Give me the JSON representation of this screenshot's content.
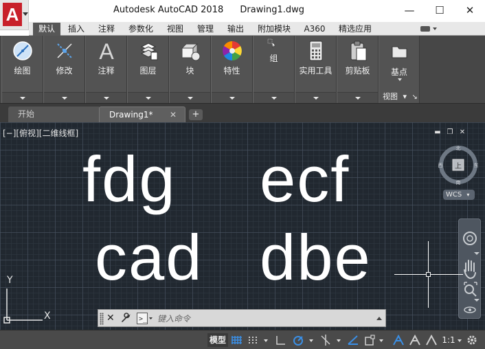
{
  "window": {
    "app_name": "Autodesk AutoCAD 2018",
    "document": "Drawing1.dwg",
    "minimize": "—",
    "maximize": "☐",
    "close": "✕",
    "app_logo_letter": "A"
  },
  "ribbon_tabs": [
    {
      "label": "默认",
      "active": true
    },
    {
      "label": "插入"
    },
    {
      "label": "注释"
    },
    {
      "label": "参数化"
    },
    {
      "label": "视图"
    },
    {
      "label": "管理"
    },
    {
      "label": "输出"
    },
    {
      "label": "附加模块"
    },
    {
      "label": "A360"
    },
    {
      "label": "精选应用"
    }
  ],
  "ribbon_panels": [
    {
      "label": "绘图",
      "icon": "draw-icon"
    },
    {
      "label": "修改",
      "icon": "modify-icon"
    },
    {
      "label": "注释",
      "icon": "annotation-icon"
    },
    {
      "label": "图层",
      "icon": "layers-icon"
    },
    {
      "label": "块",
      "icon": "block-icon"
    },
    {
      "label": "特性",
      "icon": "properties-icon"
    },
    {
      "label": "组",
      "icon": "group-icon"
    },
    {
      "label": "实用工具",
      "icon": "utilities-icon"
    },
    {
      "label": "剪贴板",
      "icon": "clipboard-icon"
    },
    {
      "label": "基点",
      "icon": "base-point-icon"
    }
  ],
  "view_panel_label": "视图",
  "file_tabs": {
    "start": "开始",
    "drawing": "Drawing1*",
    "close": "✕",
    "add": "+"
  },
  "viewport": {
    "label": "[−][俯视][二维线框]",
    "texts": [
      "fdg",
      "ecf",
      "cad",
      "dbe"
    ],
    "viewcube": {
      "top": "上",
      "north": "北",
      "south": "南",
      "east": "东",
      "west": "西"
    },
    "wcs": "WCS",
    "ucs_y": "Y",
    "ucs_x": "X"
  },
  "command_line": {
    "placeholder": "键入命令"
  },
  "status_bar": {
    "model": "模型",
    "scale": "1:1"
  },
  "colors": {
    "viewport_bg": "#212830",
    "ribbon_bg": "#535353",
    "active_tab": "#575757",
    "accent_blue": "#3a8fe6",
    "logo_red": "#c8202a"
  }
}
